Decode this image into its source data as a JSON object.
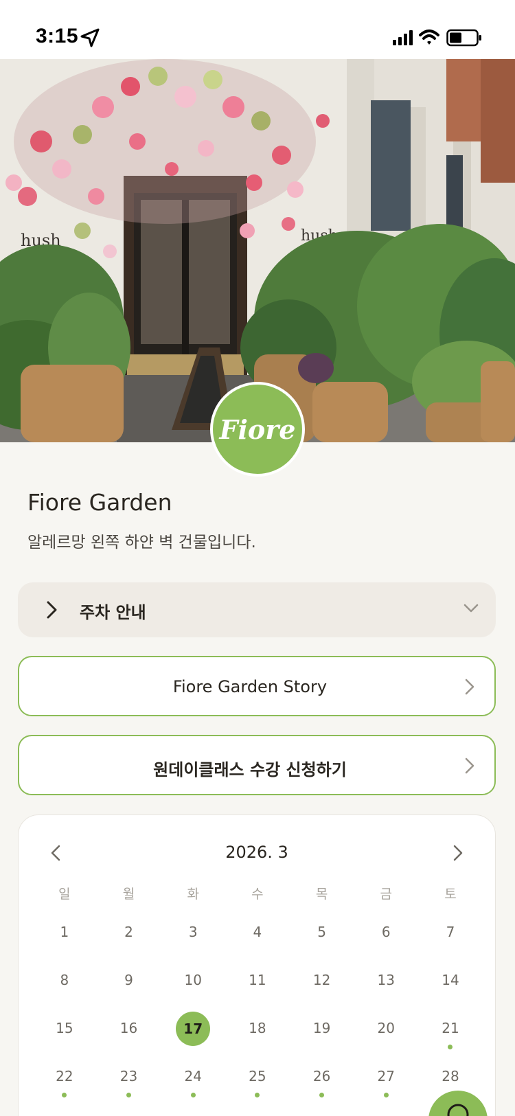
{
  "status_bar": {
    "time": "3:15"
  },
  "hero": {
    "logo_text": "Fiore"
  },
  "shop": {
    "title": "Fiore Garden",
    "description": "알레르망 왼쪽 하얀 벽 건물입니다."
  },
  "parking": {
    "label": "주차 안내"
  },
  "buttons": {
    "story": "Fiore Garden Story",
    "class_apply": "원데이클래스 수강 신청하기"
  },
  "calendar": {
    "month_label": "2026. 3",
    "weekdays": [
      "일",
      "월",
      "화",
      "수",
      "목",
      "금",
      "토"
    ],
    "weeks": [
      [
        "1",
        "2",
        "3",
        "4",
        "5",
        "6",
        "7"
      ],
      [
        "8",
        "9",
        "10",
        "11",
        "12",
        "13",
        "14"
      ],
      [
        "15",
        "16",
        "17",
        "18",
        "19",
        "20",
        "21"
      ],
      [
        "22",
        "23",
        "24",
        "25",
        "26",
        "27",
        "28"
      ]
    ],
    "selected_day": "17",
    "days_with_events": [
      "21",
      "22",
      "23",
      "24",
      "25",
      "26",
      "27",
      "28"
    ]
  },
  "colors": {
    "accent": "#8cbc57",
    "background": "#f7f6f2",
    "accordion_bg": "#efebe5"
  }
}
